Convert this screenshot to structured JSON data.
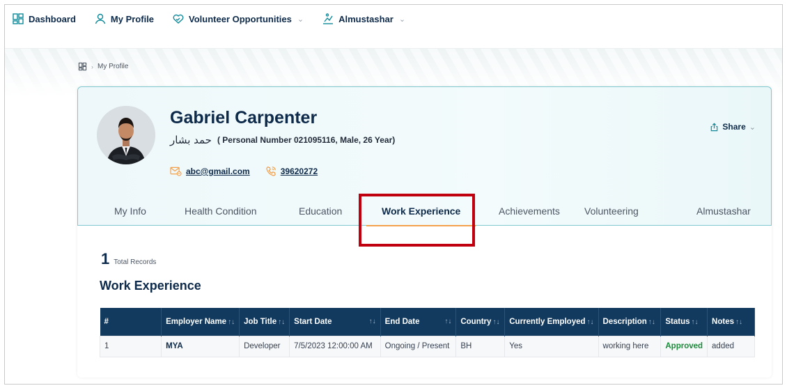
{
  "nav": {
    "items": [
      {
        "label": "Dashboard",
        "icon": "dashboard-icon",
        "dropdown": false
      },
      {
        "label": "My Profile",
        "icon": "user-icon",
        "dropdown": false
      },
      {
        "label": "Volunteer Opportunities",
        "icon": "handshake-heart-icon",
        "dropdown": true
      },
      {
        "label": "Almustashar",
        "icon": "almustashar-icon",
        "dropdown": true
      }
    ]
  },
  "breadcrumb": {
    "current": "My Profile"
  },
  "profile": {
    "name": "Gabriel Carpenter",
    "arabic_name": "حمد بشار",
    "details": "( Personal Number 021095116, Male, 26 Year)",
    "email": "abc@gmail.com",
    "phone": "39620272",
    "share_label": "Share"
  },
  "tabs": [
    {
      "label": "My Info",
      "active": false
    },
    {
      "label": "Health Condition",
      "active": false
    },
    {
      "label": "Education",
      "active": false
    },
    {
      "label": "Work Experience",
      "active": true
    },
    {
      "label": "Achievements",
      "active": false
    },
    {
      "label": "Volunteering",
      "active": false
    },
    {
      "label": "Almustashar",
      "active": false
    }
  ],
  "records": {
    "count": "1",
    "label": "Total Records"
  },
  "section_title": "Work Experience",
  "table": {
    "columns": [
      "#",
      "Employer Name",
      "Job Title",
      "Start Date",
      "End Date",
      "Country",
      "Currently Employed",
      "Description",
      "Status",
      "Notes"
    ],
    "rows": [
      [
        "1",
        "MYA",
        "Developer",
        "7/5/2023 12:00:00 AM",
        "Ongoing / Present",
        "BH",
        "Yes",
        "working here",
        "Approved",
        "added"
      ]
    ]
  },
  "colors": {
    "navy": "#0d2a4a",
    "table_header": "#123a5e",
    "accent_orange": "#f5a04a",
    "approved_green": "#1a8c3a",
    "highlight_red": "#c0000f"
  }
}
